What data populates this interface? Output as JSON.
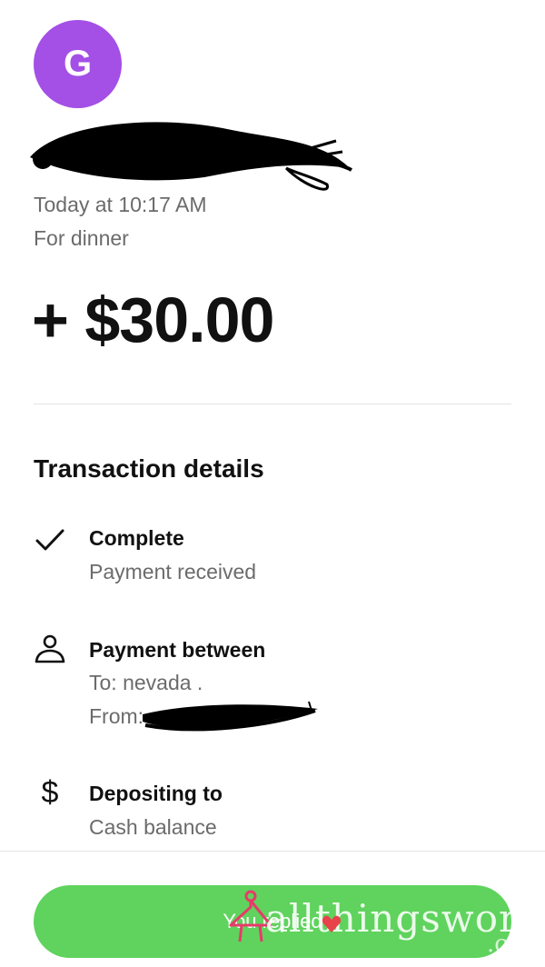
{
  "sender": {
    "avatar_initial": "G",
    "avatar_color": "#a44fe6"
  },
  "transaction": {
    "time": "Today at 10:17 AM",
    "note": "For dinner",
    "amount": "+ $30.00"
  },
  "details": {
    "title": "Transaction details",
    "rows": [
      {
        "icon": "checkmark-icon",
        "title": "Complete",
        "lines": [
          "Payment received"
        ]
      },
      {
        "icon": "person-icon",
        "title": "Payment between",
        "lines": [
          "To: nevada .",
          "From:"
        ]
      },
      {
        "icon": "dollar-icon",
        "title": "Depositing to",
        "lines": [
          "Cash balance"
        ]
      }
    ]
  },
  "action": {
    "button_label": "You replied",
    "button_color": "#5fd35d"
  },
  "watermark": {
    "text": "allthingswor",
    "suffix": ".co"
  }
}
